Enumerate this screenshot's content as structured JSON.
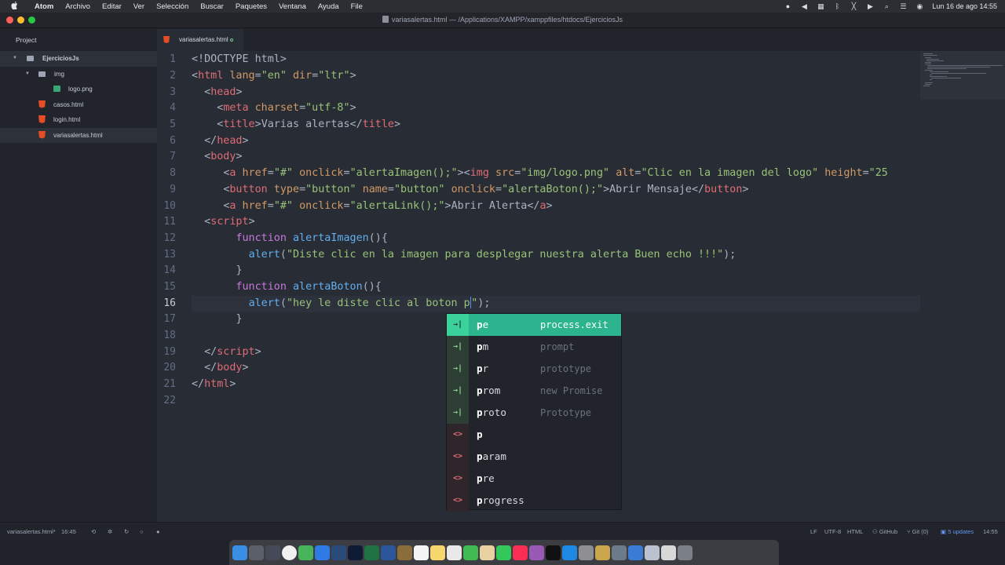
{
  "menubar": {
    "app": "Atom",
    "items": [
      "Archivo",
      "Editar",
      "Ver",
      "Selección",
      "Buscar",
      "Paquetes",
      "Ventana",
      "Ayuda",
      "File"
    ],
    "clock": "Lun 16 de ago  14:55"
  },
  "window": {
    "title": "variasalertas.html — /Applications/XAMPP/xamppfiles/htdocs/EjerciciosJs"
  },
  "sidebar": {
    "header": "Project",
    "root": "EjerciciosJs",
    "folder": "img",
    "files": {
      "logo": "logo.png",
      "casos": "casos.html",
      "login": "login.html",
      "varias": "variasalertas.html"
    }
  },
  "tab": {
    "label": "variasalertas.html"
  },
  "editor": {
    "line_numbers": [
      "1",
      "2",
      "3",
      "4",
      "5",
      "6",
      "7",
      "8",
      "9",
      "10",
      "11",
      "12",
      "13",
      "14",
      "15",
      "16",
      "17",
      "18",
      "19",
      "20",
      "21",
      "22"
    ],
    "current_line": "16",
    "code": {
      "l1": "<!DOCTYPE html>",
      "l2_tag": "html",
      "l2_lang_attr": "lang",
      "l2_lang_val": "\"en\"",
      "l2_dir_attr": "dir",
      "l2_dir_val": "\"ltr\"",
      "l3_tag": "head",
      "l4_tag": "meta",
      "l4_attr": "charset",
      "l4_val": "\"utf-8\"",
      "l5_tag": "title",
      "l5_text": "Varias alertas",
      "l6_tag": "head",
      "l7_tag": "body",
      "l8_a": "a",
      "l8_href": "href",
      "l8_href_val": "\"#\"",
      "l8_onclick": "onclick",
      "l8_onclick_val": "\"alertaImagen();\"",
      "l8_img": "img",
      "l8_src": "src",
      "l8_src_val": "\"img/logo.png\"",
      "l8_alt": "alt",
      "l8_alt_val": "\"Clic en la imagen del logo\"",
      "l8_height": "height",
      "l8_height_val": "\"25",
      "l9_button": "button",
      "l9_type": "type",
      "l9_type_val": "\"button\"",
      "l9_name": "name",
      "l9_name_val": "\"button\"",
      "l9_onclick": "onclick",
      "l9_onclick_val": "\"alertaBoton();\"",
      "l9_text": "Abrir Mensaje",
      "l10_a": "a",
      "l10_href": "href",
      "l10_href_val": "\"#\"",
      "l10_onclick": "onclick",
      "l10_onclick_val": "\"alertaLink();\"",
      "l10_text": "Abrir Alerta",
      "l11_tag": "script",
      "l12_kw": "function",
      "l12_fn": "alertaImagen",
      "l12_rest": "(){",
      "l13_fn": "alert",
      "l13_str": "\"Diste clic en la imagen para desplegar nuestra alerta Buen echo !!!\"",
      "l13_end": ");",
      "l14": "}",
      "l15_kw": "function",
      "l15_fn": "alertaBoton",
      "l15_rest": "(){",
      "l16_fn": "alert",
      "l16_str": "\"hey le diste clic al boton p",
      "l16_str_end": "\"",
      "l16_end": ");",
      "l17": "}",
      "l19_tag": "script",
      "l20_tag": "body",
      "l21_tag": "html"
    }
  },
  "autocomplete": {
    "items": [
      {
        "match": "p",
        "rest": "e",
        "right": "process.exit",
        "kind": "snippet"
      },
      {
        "match": "p",
        "rest": "m",
        "right": "prompt",
        "kind": "snippet"
      },
      {
        "match": "p",
        "rest": "r",
        "right": "prototype",
        "kind": "snippet"
      },
      {
        "match": "p",
        "rest": "rom",
        "right": "new Promise",
        "kind": "snippet"
      },
      {
        "match": "p",
        "rest": "roto",
        "right": "Prototype",
        "kind": "snippet"
      },
      {
        "match": "p",
        "rest": "",
        "right": "",
        "kind": "tag"
      },
      {
        "match": "p",
        "rest": "aram",
        "right": "",
        "kind": "tag"
      },
      {
        "match": "p",
        "rest": "re",
        "right": "",
        "kind": "tag"
      },
      {
        "match": "p",
        "rest": "rogress",
        "right": "",
        "kind": "tag"
      }
    ]
  },
  "statusbar": {
    "file": "variasalertas.html*",
    "cursor": "16:45",
    "line_ending": "LF",
    "encoding": "UTF-8",
    "grammar": "HTML",
    "github": "GitHub",
    "git": "Git (0)",
    "updates": "5 updates",
    "time": "14:55"
  },
  "colors": {
    "accent": "#2bb48e",
    "editor_bg": "#282c34",
    "sidebar_bg": "#21252b",
    "tag": "#e06c75",
    "attr": "#d19a66",
    "string": "#98c379",
    "keyword": "#c678dd",
    "function": "#61afef"
  }
}
